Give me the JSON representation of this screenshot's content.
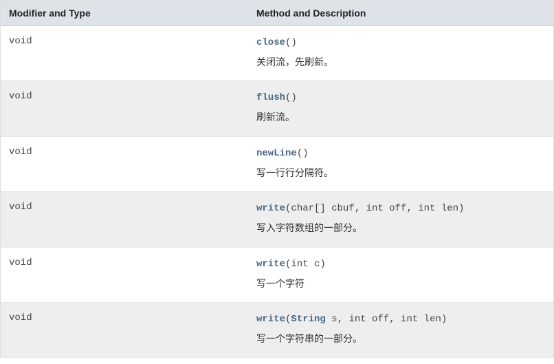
{
  "headers": {
    "modifier": "Modifier and Type",
    "method": "Method and Description"
  },
  "rows": [
    {
      "modifier": "void",
      "method": "close",
      "params_pre": "(",
      "type_link": "",
      "params_post": ")",
      "desc": "关闭流，先刷新。"
    },
    {
      "modifier": "void",
      "method": "flush",
      "params_pre": "(",
      "type_link": "",
      "params_post": ")",
      "desc": "刷新流。"
    },
    {
      "modifier": "void",
      "method": "newLine",
      "params_pre": "(",
      "type_link": "",
      "params_post": ")",
      "desc": "写一行行分隔符。"
    },
    {
      "modifier": "void",
      "method": "write",
      "params_pre": "(char[] cbuf, int off, int len)",
      "type_link": "",
      "params_post": "",
      "desc": "写入字符数组的一部分。"
    },
    {
      "modifier": "void",
      "method": "write",
      "params_pre": "(int c)",
      "type_link": "",
      "params_post": "",
      "desc": "写一个字符"
    },
    {
      "modifier": "void",
      "method": "write",
      "params_pre": "(",
      "type_link": "String",
      "params_post": " s, int off, int len)",
      "desc": "写一个字符串的一部分。"
    }
  ]
}
